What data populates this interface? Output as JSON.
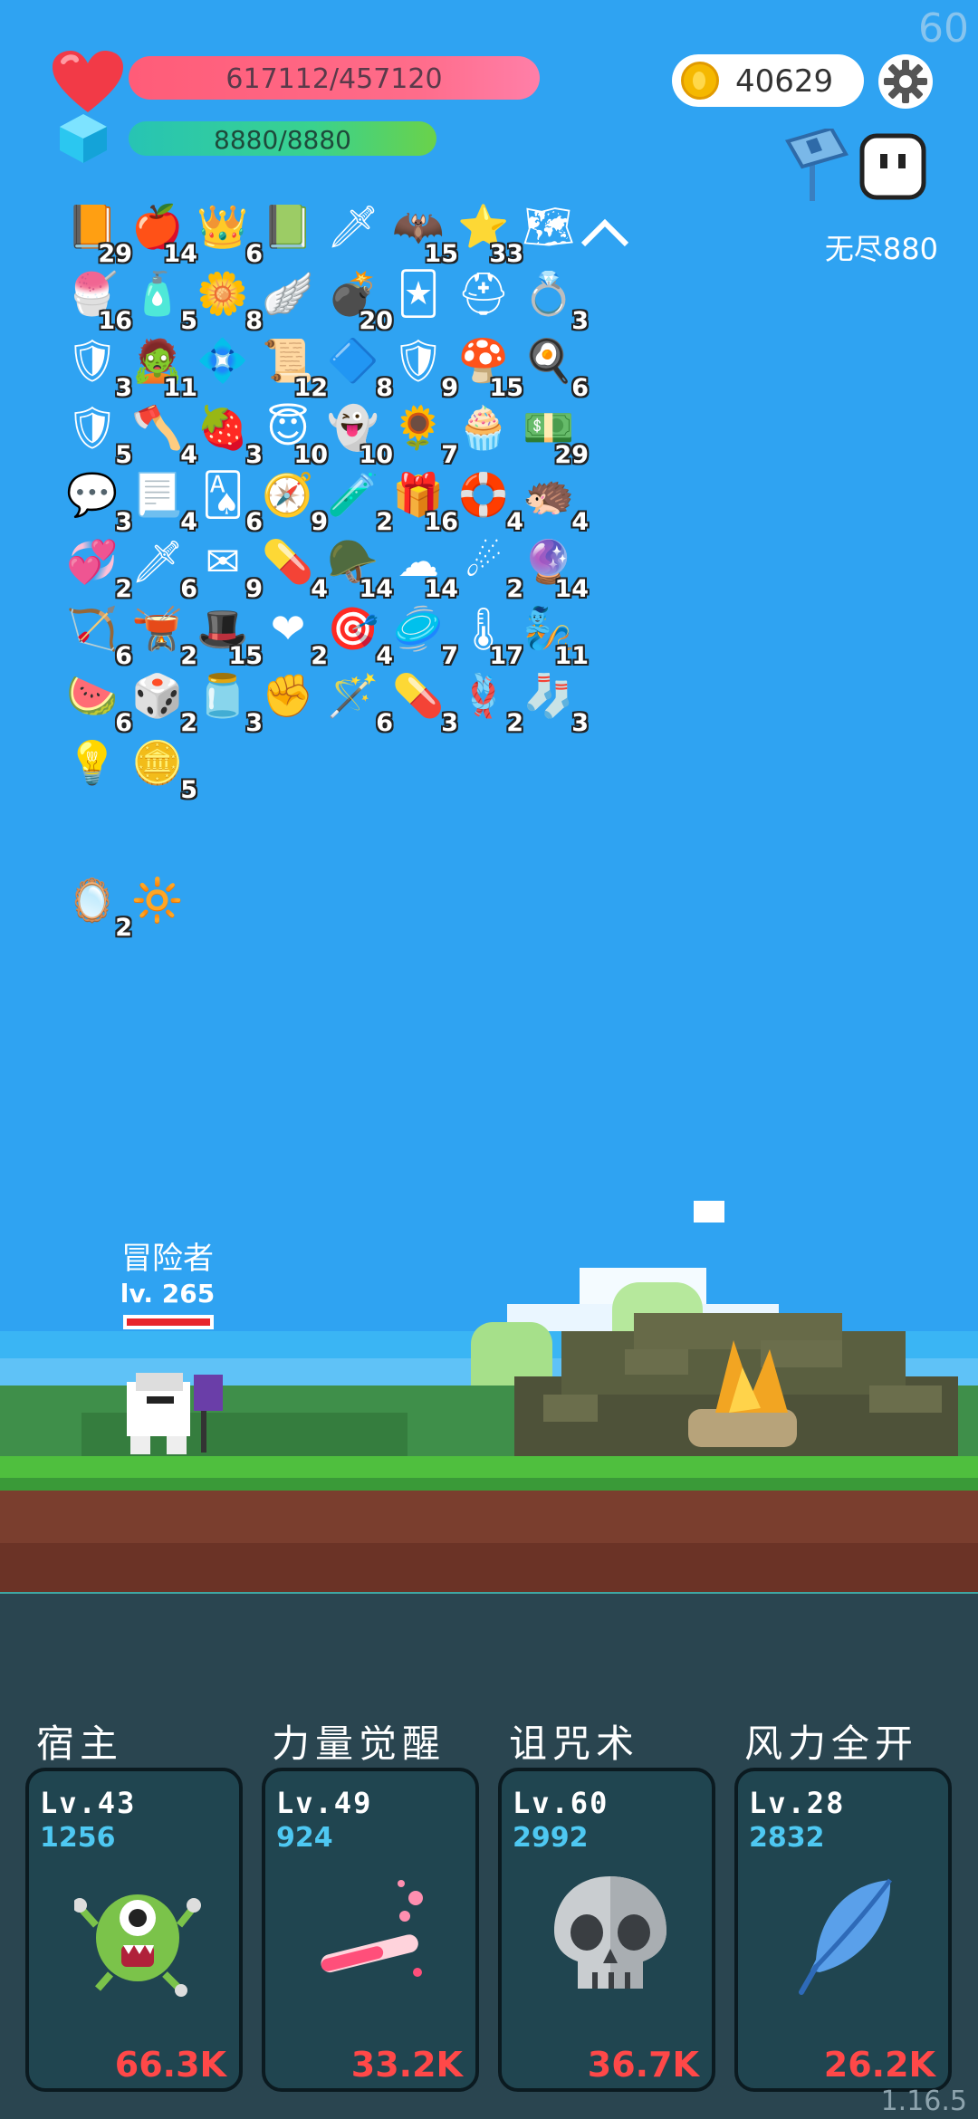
{
  "fps": "60",
  "hp": {
    "text": "617112/457120"
  },
  "mp": {
    "text": "8880/8880"
  },
  "gold": "40629",
  "endless_label": "无尽880",
  "inventory": [
    {
      "icon": "📙",
      "count": "29"
    },
    {
      "icon": "🍎",
      "count": "14"
    },
    {
      "icon": "👑",
      "count": "6"
    },
    {
      "icon": "📗",
      "count": ""
    },
    {
      "icon": "🗡",
      "count": ""
    },
    {
      "icon": "🦇",
      "count": "15"
    },
    {
      "icon": "⭐",
      "count": "33"
    },
    {
      "icon": "🗺",
      "count": ""
    },
    {
      "icon": "🍧",
      "count": "16"
    },
    {
      "icon": "🧴",
      "count": "5"
    },
    {
      "icon": "🌼",
      "count": "8"
    },
    {
      "icon": "🪽",
      "count": ""
    },
    {
      "icon": "💣",
      "count": "20"
    },
    {
      "icon": "🃏",
      "count": ""
    },
    {
      "icon": "⛑",
      "count": ""
    },
    {
      "icon": "💍",
      "count": "3"
    },
    {
      "icon": "🛡",
      "count": "3"
    },
    {
      "icon": "🧟",
      "count": "11"
    },
    {
      "icon": "💠",
      "count": ""
    },
    {
      "icon": "📜",
      "count": "12"
    },
    {
      "icon": "🔷",
      "count": "8"
    },
    {
      "icon": "🛡",
      "count": "9"
    },
    {
      "icon": "🍄",
      "count": "15"
    },
    {
      "icon": "🍳",
      "count": "6"
    },
    {
      "icon": "🛡",
      "count": "5"
    },
    {
      "icon": "🪓",
      "count": "4"
    },
    {
      "icon": "🍓",
      "count": "3"
    },
    {
      "icon": "😇",
      "count": "10"
    },
    {
      "icon": "👻",
      "count": "10"
    },
    {
      "icon": "🌻",
      "count": "7"
    },
    {
      "icon": "🧁",
      "count": ""
    },
    {
      "icon": "💵",
      "count": "29"
    },
    {
      "icon": "💬",
      "count": "3"
    },
    {
      "icon": "📃",
      "count": "4"
    },
    {
      "icon": "🂡",
      "count": "6"
    },
    {
      "icon": "🧭",
      "count": "9"
    },
    {
      "icon": "🧪",
      "count": "2"
    },
    {
      "icon": "🎁",
      "count": "16"
    },
    {
      "icon": "🛟",
      "count": "4"
    },
    {
      "icon": "🦔",
      "count": "4"
    },
    {
      "icon": "💞",
      "count": "2"
    },
    {
      "icon": "🗡",
      "count": "6"
    },
    {
      "icon": "✉",
      "count": "9"
    },
    {
      "icon": "💊",
      "count": "4"
    },
    {
      "icon": "🪖",
      "count": "14"
    },
    {
      "icon": "☁",
      "count": "14"
    },
    {
      "icon": "☄",
      "count": "2"
    },
    {
      "icon": "🔮",
      "count": "14"
    },
    {
      "icon": "🏹",
      "count": "6"
    },
    {
      "icon": "🫕",
      "count": "2"
    },
    {
      "icon": "🎩",
      "count": "15"
    },
    {
      "icon": "❤",
      "count": "2"
    },
    {
      "icon": "🎯",
      "count": "4"
    },
    {
      "icon": "🥏",
      "count": "7"
    },
    {
      "icon": "🌡",
      "count": "17"
    },
    {
      "icon": "🧞",
      "count": "11"
    },
    {
      "icon": "🍉",
      "count": "6"
    },
    {
      "icon": "🎲",
      "count": "2"
    },
    {
      "icon": "🫙",
      "count": "3"
    },
    {
      "icon": "✊",
      "count": ""
    },
    {
      "icon": "🪄",
      "count": "6"
    },
    {
      "icon": "💊",
      "count": "3"
    },
    {
      "icon": "🪢",
      "count": "2"
    },
    {
      "icon": "🧦",
      "count": "3"
    },
    {
      "icon": "💡",
      "count": ""
    },
    {
      "icon": "🪙",
      "count": "5"
    }
  ],
  "special_items": [
    {
      "icon": "🪞",
      "count": "2"
    },
    {
      "icon": "🔆",
      "count": ""
    }
  ],
  "hero": {
    "name": "冒险者",
    "level": "lv. 265"
  },
  "skills": [
    {
      "title": "宿主",
      "level": "Lv.43",
      "cost": "1256",
      "damage": "66.3K",
      "icon": "green-monster"
    },
    {
      "title": "力量觉醒",
      "level": "Lv.49",
      "cost": "924",
      "damage": "33.2K",
      "icon": "potion-tube"
    },
    {
      "title": "诅咒术",
      "level": "Lv.60",
      "cost": "2992",
      "damage": "36.7K",
      "icon": "skull"
    },
    {
      "title": "风力全开",
      "level": "Lv.28",
      "cost": "2832",
      "damage": "26.2K",
      "icon": "blue-feather"
    }
  ],
  "version": "1.16.5"
}
